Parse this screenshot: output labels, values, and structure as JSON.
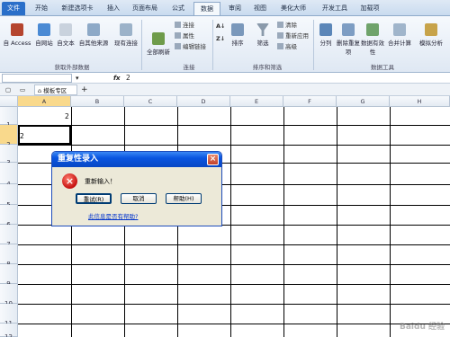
{
  "ribbon_tabs": [
    "文件",
    "开始",
    "新建选项卡",
    "插入",
    "页面布局",
    "公式",
    "数据",
    "审阅",
    "视图",
    "美化大师",
    "开发工具",
    "加载项"
  ],
  "active_tab": "数据",
  "ribbon": {
    "external_data": {
      "buttons": [
        "自 Access",
        "自网站",
        "自文本",
        "自其他来源",
        "现有连接"
      ],
      "label": "获取外部数据"
    },
    "connections": {
      "refresh": "全部刷新",
      "small": [
        "连接",
        "属性",
        "编辑链接"
      ],
      "label": "连接"
    },
    "sort_filter": {
      "buttons": [
        "排序",
        "筛选"
      ],
      "small": [
        "清除",
        "重新应用",
        "高级"
      ],
      "label": "排序和筛选"
    },
    "data_tools": {
      "buttons": [
        "分列",
        "删除重复项",
        "数据有效性",
        "合并计算",
        "模拟分析"
      ],
      "label": "数据工具"
    }
  },
  "formula_bar": {
    "fx": "fx",
    "value": "2"
  },
  "sheet_tab": "模板专区",
  "columns": [
    "A",
    "B",
    "C",
    "D",
    "E",
    "F",
    "G",
    "H"
  ],
  "rows": [
    "1",
    "2",
    "3",
    "4",
    "5",
    "6",
    "7",
    "8",
    "9",
    "10",
    "11",
    "12"
  ],
  "cells": {
    "A1": "2",
    "A2": "2"
  },
  "dialog": {
    "title": "重复性录入",
    "close": "×",
    "error_icon": "×",
    "message": "重新输入！",
    "buttons": [
      "重试(R)",
      "取消",
      "帮助(H)"
    ],
    "link": "此信息是否有帮助?"
  },
  "watermark": "Baidu 经验"
}
